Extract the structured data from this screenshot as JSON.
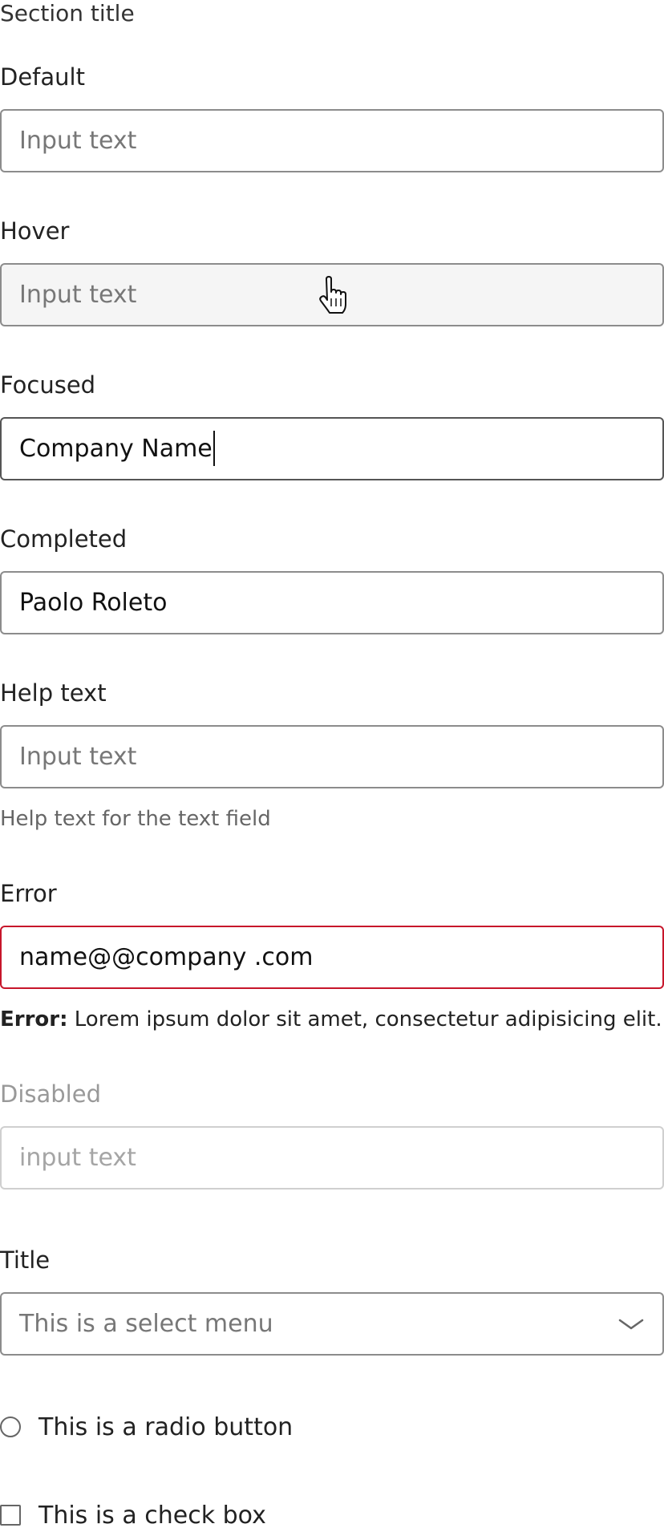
{
  "section_title": "Section title",
  "fields": {
    "default": {
      "label": "Default",
      "placeholder": "Input text"
    },
    "hover": {
      "label": "Hover",
      "placeholder": "Input text"
    },
    "focused": {
      "label": "Focused",
      "value": "Company Name"
    },
    "completed": {
      "label": "Completed",
      "value": "Paolo Roleto"
    },
    "help": {
      "label": "Help text",
      "placeholder": "Input text",
      "help_text": "Help text for the text field"
    },
    "error": {
      "label": "Error",
      "value": "name@@company .com",
      "message_prefix": "Error:",
      "message": " Lorem ipsum dolor sit amet, consectetur adipisicing elit."
    },
    "disabled": {
      "label": "Disabled",
      "placeholder": "input text"
    }
  },
  "select": {
    "label": "Title",
    "placeholder": "This is a select menu"
  },
  "radio": {
    "label": "This is a radio button"
  },
  "checkbox": {
    "label": "This is a check box"
  },
  "icons": {
    "select": "chevron-down-icon",
    "cursor": "hand-cursor-icon"
  },
  "colors": {
    "border": "#8c8c8c",
    "hover_bg": "#f5f5f5",
    "error": "#c7162b",
    "disabled_border": "#cfcfcf"
  }
}
